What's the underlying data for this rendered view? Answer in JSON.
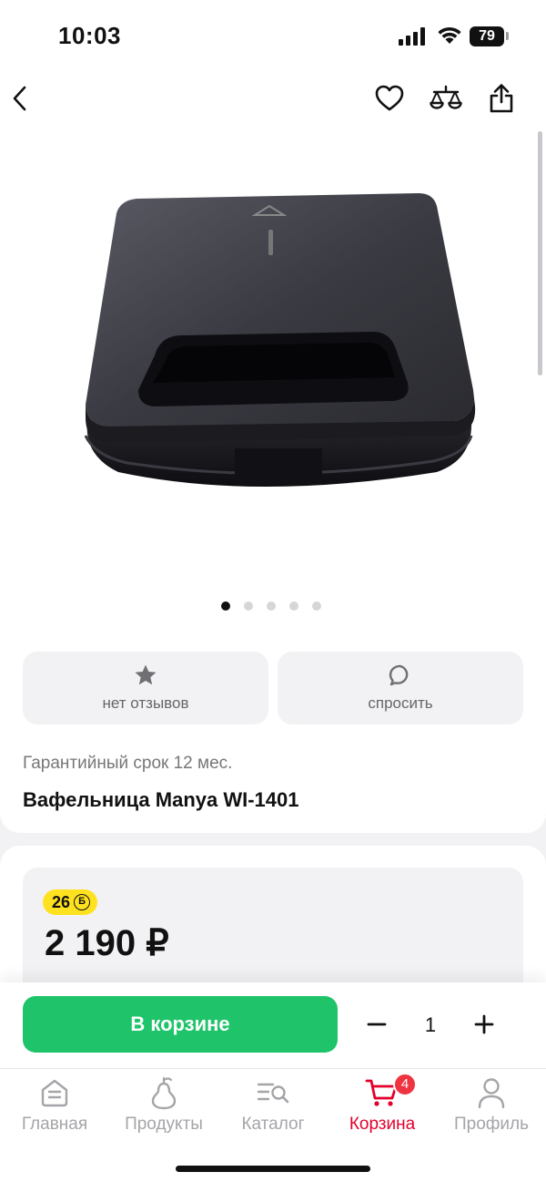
{
  "status_bar": {
    "time": "10:03",
    "battery": "79"
  },
  "nav": {
    "back_icon": "chevron-left-icon",
    "favorite_icon": "heart-icon",
    "compare_icon": "scales-icon",
    "share_icon": "share-icon"
  },
  "gallery": {
    "image_count": 5,
    "active_index": 0,
    "image_name": "waffle-maker-photo"
  },
  "actions": {
    "reviews": {
      "label": "нет отзывов",
      "icon": "star-icon"
    },
    "ask": {
      "label": "спросить",
      "icon": "chat-bubble-icon"
    }
  },
  "product": {
    "warranty": "Гарантийный срок 12 мес.",
    "title": "Вафельница Manya WI-1401"
  },
  "price": {
    "bonus": "26",
    "bonus_symbol": "Б",
    "value": "2 190 ₽"
  },
  "cart_bar": {
    "in_cart_label": "В корзине",
    "quantity": "1",
    "minus_icon": "minus-icon",
    "plus_icon": "plus-icon"
  },
  "tabs": [
    {
      "label": "Главная",
      "icon": "home-icon",
      "active": false
    },
    {
      "label": "Продукты",
      "icon": "pear-icon",
      "active": false
    },
    {
      "label": "Каталог",
      "icon": "catalog-search-icon",
      "active": false
    },
    {
      "label": "Корзина",
      "icon": "cart-icon",
      "active": true,
      "badge": "4"
    },
    {
      "label": "Профиль",
      "icon": "profile-icon",
      "active": false
    }
  ],
  "colors": {
    "accent_green": "#1fc46a",
    "active_red": "#e3002b",
    "badge_red": "#ef3340",
    "bonus_yellow": "#ffe21f",
    "inactive_gray": "#a5a5a9",
    "background": "#f2f2f4"
  }
}
